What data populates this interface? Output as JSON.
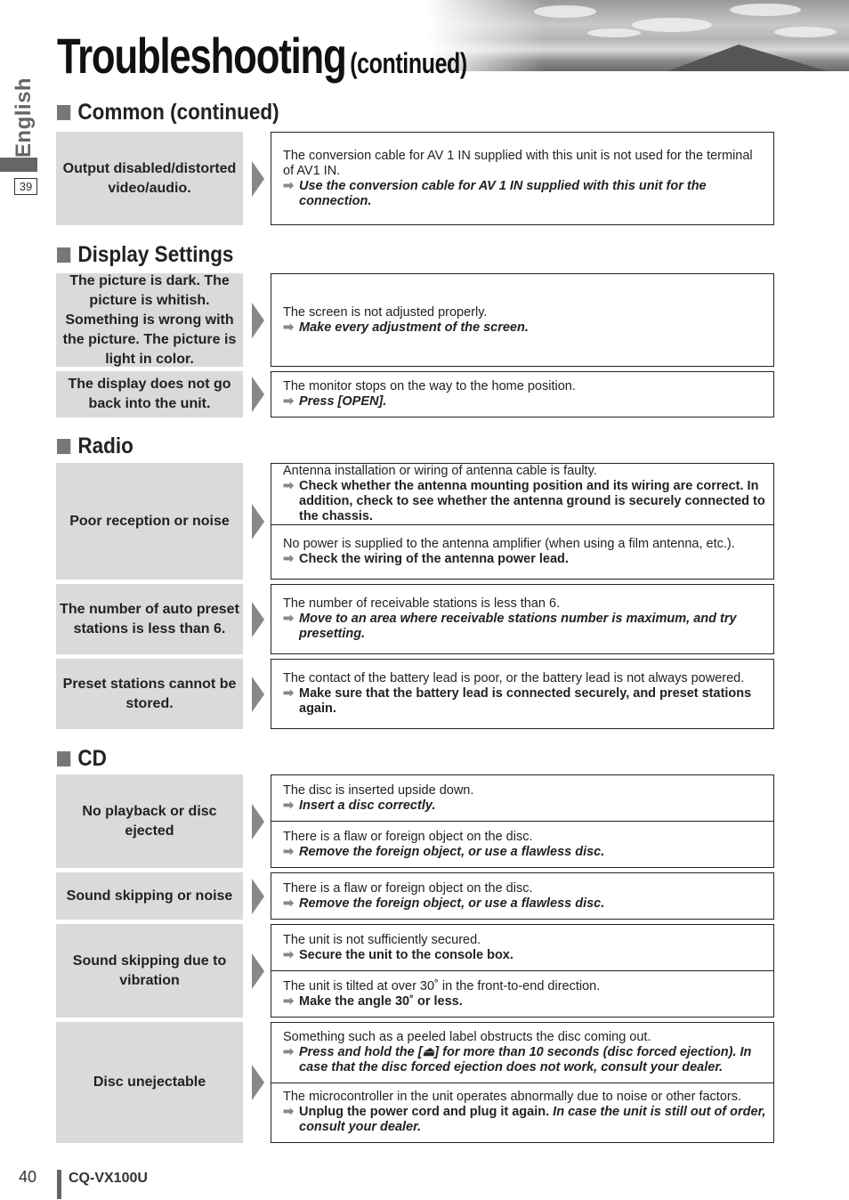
{
  "header": {
    "title": "Troubleshooting",
    "subtitle": "(continued)"
  },
  "side": {
    "language": "English",
    "page_ref": "39"
  },
  "arrow_glyph": "➡",
  "sections": [
    {
      "heading": "Common (continued)",
      "rows": [
        {
          "problem": "Output disabled/distorted video/audio.",
          "cells": [
            {
              "cause": "The conversion cable for AV 1 IN supplied with this unit is not used for the terminal of AV1 IN.",
              "fix": "Use the conversion cable for AV 1 IN supplied with this unit for the connection.",
              "fix_style": "italic"
            }
          ]
        }
      ]
    },
    {
      "heading": "Display Settings",
      "rows": [
        {
          "problem": "The picture is dark. The picture is whitish. Something is wrong with the picture. The picture is light in color.",
          "cells": [
            {
              "cause": "The screen is not adjusted properly.",
              "fix": "Make every adjustment of the screen.",
              "fix_style": "italic"
            }
          ]
        },
        {
          "problem": "The display does not go back into the unit.",
          "cells": [
            {
              "cause": "The monitor stops on the way to the home position.",
              "fix": "Press [OPEN].",
              "fix_style": "italic"
            }
          ]
        }
      ]
    },
    {
      "heading": "Radio",
      "rows": [
        {
          "problem": "Poor reception or noise",
          "cells": [
            {
              "cause": "Antenna installation or wiring of antenna cable is faulty.",
              "fix": "Check whether the antenna mounting position and its wiring are correct. In addition, check to see whether the antenna ground is securely connected to the chassis.",
              "fix_style": "bold"
            },
            {
              "cause": "No power is supplied to the antenna amplifier (when using a film antenna, etc.).",
              "fix": "Check the wiring of the antenna power lead.",
              "fix_style": "bold"
            }
          ]
        },
        {
          "problem": "The number of auto preset stations is less than 6.",
          "cells": [
            {
              "cause": "The number of receivable stations is less than 6.",
              "fix": "Move to an area where receivable stations number is maximum, and try presetting.",
              "fix_style": "italic"
            }
          ]
        },
        {
          "problem": "Preset stations cannot be stored.",
          "cells": [
            {
              "cause": "The contact of the battery lead is poor, or the battery lead is not always powered.",
              "fix": "Make sure that the battery lead is connected securely, and preset stations again.",
              "fix_style": "bold"
            }
          ]
        }
      ]
    },
    {
      "heading": "CD",
      "rows": [
        {
          "problem": "No playback or disc ejected",
          "cells": [
            {
              "cause": "The disc is inserted upside down.",
              "fix": "Insert a disc correctly.",
              "fix_style": "italic"
            },
            {
              "cause": "There is a flaw or foreign object on the disc.",
              "fix": "Remove the foreign object, or use a flawless disc.",
              "fix_style": "italic"
            }
          ]
        },
        {
          "problem": "Sound skipping or noise",
          "cells": [
            {
              "cause": "There is a flaw or foreign object on the disc.",
              "fix": "Remove the foreign object, or use a flawless disc.",
              "fix_style": "italic"
            }
          ]
        },
        {
          "problem": "Sound skipping due to vibration",
          "cells": [
            {
              "cause": "The unit is not sufficiently secured.",
              "fix": "Secure the unit to the console box.",
              "fix_style": "bold"
            },
            {
              "cause": "The unit is tilted at over 30˚ in the front-to-end direction.",
              "fix": "Make the angle 30˚ or less.",
              "fix_style": "bold"
            }
          ]
        },
        {
          "problem": "Disc unejectable",
          "cells": [
            {
              "cause": "Something such as a peeled label obstructs the disc coming out.",
              "fix": "Press and hold the [⏏] for more than 10 seconds (disc forced ejection). In case that the disc forced ejection does not work, consult your dealer.",
              "fix_style": "italic"
            },
            {
              "cause": "The microcontroller in the unit operates abnormally due to noise or other factors.",
              "fix": "Unplug the power cord and plug it again.",
              "fix_extra_italic": "In case the unit is still out of order, consult your dealer.",
              "fix_style": "bold"
            }
          ]
        }
      ]
    }
  ],
  "footer": {
    "page_number": "40",
    "model": "CQ-VX100U"
  }
}
